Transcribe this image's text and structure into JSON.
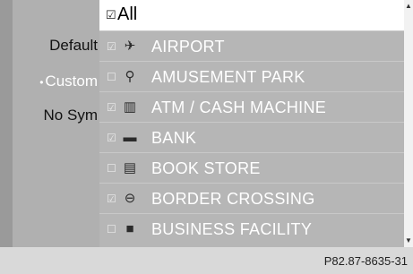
{
  "menu": {
    "items": [
      {
        "label": "Default",
        "selected": false
      },
      {
        "label": "Custom",
        "selected": true
      },
      {
        "label": "No Sym",
        "selected": false
      }
    ]
  },
  "list": {
    "all_label": "All",
    "checkbox_glyph_checked": "☑",
    "checkbox_glyph_unchecked": "☐",
    "rows": [
      {
        "label": "AIRPORT",
        "icon": "airplane-icon",
        "checked": true
      },
      {
        "label": "AMUSEMENT PARK",
        "icon": "balloons-icon",
        "checked": false
      },
      {
        "label": "ATM / CASH MACHINE",
        "icon": "atm-icon",
        "checked": true
      },
      {
        "label": "BANK",
        "icon": "bank-icon",
        "checked": true
      },
      {
        "label": "BOOK STORE",
        "icon": "book-icon",
        "checked": false
      },
      {
        "label": "BORDER CROSSING",
        "icon": "border-crossing-icon",
        "checked": true
      },
      {
        "label": "BUSINESS FACILITY",
        "icon": "building-icon",
        "checked": false
      }
    ]
  },
  "footer": {
    "reference": "P82.87-8635-31"
  },
  "colors": {
    "selected_text": "#ffffff",
    "highlight_row": "#ffffff",
    "list_background": "#b6b6b6"
  }
}
